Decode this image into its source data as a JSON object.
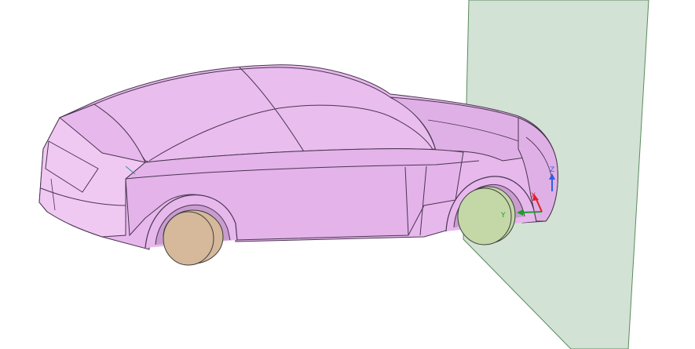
{
  "colors": {
    "background": "#ffffff",
    "body": "#e7b8ec",
    "body_shade": "#d9a6df",
    "body_light": "#f0c9f3",
    "edge": "#4a3550",
    "plane": "#d2e2d4",
    "plane_edge": "#5a8a5e",
    "rear_wheel": "#d6b89a",
    "front_wheel": "#c3d8a6",
    "wheel_edge": "#3d3d3d",
    "axis_x": "#e0212a",
    "axis_y": "#1f9c2d",
    "axis_z": "#2f5ee6"
  },
  "triad": {
    "x_label": "X",
    "y_label": "Y",
    "z_label": "Z"
  }
}
